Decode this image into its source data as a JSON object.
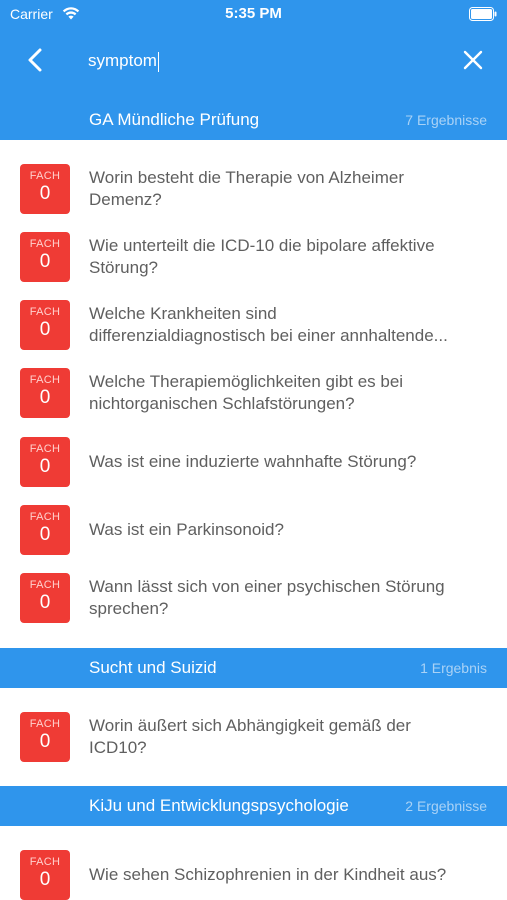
{
  "status_bar": {
    "carrier": "Carrier",
    "time": "5:35 PM"
  },
  "search": {
    "value": "symptom"
  },
  "colors": {
    "accent": "#2f95ec",
    "badge": "#ef3b35"
  },
  "icons": {
    "back": "chevron-left-icon",
    "clear": "close-icon",
    "wifi": "wifi-icon",
    "battery": "battery-icon"
  },
  "sections": [
    {
      "title": "GA Mündliche Prüfung",
      "count": "7 Ergebnisse",
      "items": [
        {
          "badge_label": "FACH",
          "badge_count": "0",
          "line1": "Worin besteht die Therapie von Alzheimer",
          "line2": "Demenz?"
        },
        {
          "badge_label": "FACH",
          "badge_count": "0",
          "line1": "Wie unterteilt die ICD-10 die bipolare affektive",
          "line2": "Störung?"
        },
        {
          "badge_label": "FACH",
          "badge_count": "0",
          "line1": "Welche Krankheiten sind",
          "line2": "differenzialdiagnostisch bei einer annhaltende..."
        },
        {
          "badge_label": "FACH",
          "badge_count": "0",
          "line1": "Welche Therapiemöglichkeiten gibt es bei",
          "line2": "nichtorganischen Schlafstörungen?"
        },
        {
          "badge_label": "FACH",
          "badge_count": "0",
          "line1": "Was ist eine induzierte wahnhafte Störung?"
        },
        {
          "badge_label": "FACH",
          "badge_count": "0",
          "line1": "Was ist ein Parkinsonoid?"
        },
        {
          "badge_label": "FACH",
          "badge_count": "0",
          "line1": "Wann lässt sich von einer psychischen Störung",
          "line2": "sprechen?"
        }
      ]
    },
    {
      "title": "Sucht und Suizid",
      "count": "1 Ergebnis",
      "items": [
        {
          "badge_label": "FACH",
          "badge_count": "0",
          "line1": "Worin äußert sich Abhängigkeit gemäß der",
          "line2": "ICD10?"
        }
      ]
    },
    {
      "title": "KiJu und Entwicklungspsychologie",
      "count": "2 Ergebnisse",
      "items": [
        {
          "badge_label": "FACH",
          "badge_count": "0",
          "line1": "Wie sehen Schizophrenien in der Kindheit aus?"
        }
      ]
    }
  ]
}
